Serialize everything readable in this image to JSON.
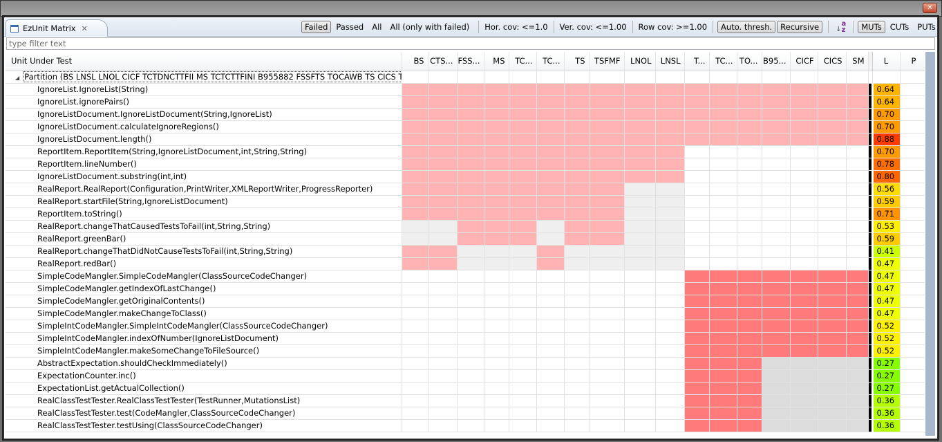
{
  "view": {
    "tab_label": "EzUnit Matrix",
    "filter_placeholder": "type filter text"
  },
  "toolbar": {
    "filters": [
      {
        "label": "Failed",
        "pressed": true
      },
      {
        "label": "Passed",
        "pressed": false
      },
      {
        "label": "All",
        "pressed": false
      },
      {
        "label": "All (only with failed)",
        "pressed": false
      }
    ],
    "hor_cov": "Hor. cov: <=1.0",
    "ver_cov": "Ver. cov: <=1.00",
    "row_cov": "Row cov: >=1.00",
    "auto_thresh": "Auto. thresh.",
    "recursive": "Recursive",
    "sort_icon": "sort-az-icon",
    "units": [
      {
        "label": "MUTs",
        "pressed": true
      },
      {
        "label": "CUTs",
        "pressed": false
      },
      {
        "label": "PUTs",
        "pressed": false
      }
    ],
    "sync_icon": "sync-icon",
    "menu_icon": "view-menu-icon"
  },
  "table": {
    "name_header": "Unit Under Test",
    "columns": [
      "BS",
      "CTS...",
      "FSS...",
      "MS",
      "TC...",
      "TC...",
      "TS",
      "TSFMF",
      "LNOL",
      "LNSL",
      "T...",
      "TC...",
      "TO...",
      "B95...",
      "CICF",
      "CICS",
      "SM"
    ],
    "l_header": "L",
    "p_header": "P",
    "partition_label": "Partition (BS LNSL LNOL CICF TCTDNCTTFII MS TCTCTTFINI B955882 FSSFTS TOCAWB TS CICS TSFMF",
    "cell_legend": {
      "p": "failed (light)",
      "r": "failed (strong)",
      "g": "not covered",
      "d": "not covered (dark)",
      "w": "empty"
    },
    "colors": {
      "p": "#ffb3b3",
      "r": "#ff7a7a",
      "g": "#efefef",
      "d": "#dcdcdc"
    },
    "rows": [
      {
        "name": "IgnoreList.IgnoreList(String)",
        "cells": "ppppppppppppppppp",
        "l": "0.64",
        "l_color": "#ffb400"
      },
      {
        "name": "IgnoreList.ignorePairs()",
        "cells": "ppppppppppppppppp",
        "l": "0.64",
        "l_color": "#ffb400"
      },
      {
        "name": "IgnoreListDocument.IgnoreListDocument(String,IgnoreList)",
        "cells": "ppppppppppppppppp",
        "l": "0.70",
        "l_color": "#ff9a00"
      },
      {
        "name": "IgnoreListDocument.calculateIgnoreRegions()",
        "cells": "ppppppppppppppppp",
        "l": "0.70",
        "l_color": "#ff9a00"
      },
      {
        "name": "IgnoreListDocument.length()",
        "cells": "ppppppppppppppppp",
        "l": "0.88",
        "l_color": "#ff3c00"
      },
      {
        "name": "ReportItem.ReportItem(String,IgnoreListDocument,int,String,String)",
        "cells": "ppppppppppwwwwwww",
        "l": "0.70",
        "l_color": "#ff9a00"
      },
      {
        "name": "ReportItem.lineNumber()",
        "cells": "ppppppppppwwwwwww",
        "l": "0.78",
        "l_color": "#ff6e00"
      },
      {
        "name": "IgnoreListDocument.substring(int,int)",
        "cells": "ppppppppppwwwwwww",
        "l": "0.80",
        "l_color": "#ff6600"
      },
      {
        "name": "RealReport.RealReport(Configuration,PrintWriter,XMLReportWriter,ProgressReporter)",
        "cells": "ppppppppggwwwwwww",
        "l": "0.56",
        "l_color": "#ffdc00"
      },
      {
        "name": "RealReport.startFile(String,IgnoreListDocument)",
        "cells": "ppppppppggwwwwwww",
        "l": "0.59",
        "l_color": "#ffcc00"
      },
      {
        "name": "ReportItem.toString()",
        "cells": "ppppppppggwwwwwww",
        "l": "0.71",
        "l_color": "#ff9400"
      },
      {
        "name": "RealReport.changeThatCausedTestsToFail(int,String,String)",
        "cells": "ggpppgppggwwwwwww",
        "l": "0.53",
        "l_color": "#ffee00"
      },
      {
        "name": "RealReport.greenBar()",
        "cells": "ggpppgppggwwwwwww",
        "l": "0.59",
        "l_color": "#ffcc00"
      },
      {
        "name": "RealReport.changeThatDidNotCauseTestsToFail(int,String,String)",
        "cells": "ppgggpggggwwwwwww",
        "l": "0.41",
        "l_color": "#ccff00"
      },
      {
        "name": "RealReport.redBar()",
        "cells": "ppgggpggggwwwwwww",
        "l": "0.47",
        "l_color": "#eeff00"
      },
      {
        "name": "SimpleCodeMangler.SimpleCodeMangler(ClassSourceCodeChanger)",
        "cells": "wwwwwwwwwwrrrrrrr",
        "l": "0.47",
        "l_color": "#eeff00"
      },
      {
        "name": "SimpleCodeMangler.getIndexOfLastChange()",
        "cells": "wwwwwwwwwwrrrrrrr",
        "l": "0.47",
        "l_color": "#eeff00"
      },
      {
        "name": "SimpleCodeMangler.getOriginalContents()",
        "cells": "wwwwwwwwwwrrrrrrr",
        "l": "0.47",
        "l_color": "#eeff00"
      },
      {
        "name": "SimpleCodeMangler.makeChangeToClass()",
        "cells": "wwwwwwwwwwrrrrrrr",
        "l": "0.47",
        "l_color": "#eeff00"
      },
      {
        "name": "SimpleIntCodeMangler.SimpleIntCodeMangler(ClassSourceCodeChanger)",
        "cells": "wwwwwwwwwwrrrrrrr",
        "l": "0.52",
        "l_color": "#fff200"
      },
      {
        "name": "SimpleIntCodeMangler.indexOfNumber(IgnoreListDocument)",
        "cells": "wwwwwwwwwwrrrrrrr",
        "l": "0.52",
        "l_color": "#fff200"
      },
      {
        "name": "SimpleIntCodeMangler.makeSomeChangeToFileSource()",
        "cells": "wwwwwwwwwwrrrrrrr",
        "l": "0.52",
        "l_color": "#fff200"
      },
      {
        "name": "AbstractExpectation.shouldCheckImmediately()",
        "cells": "wwwwwwwwwwrrrdddd",
        "l": "0.27",
        "l_color": "#88ff00"
      },
      {
        "name": "ExpectationCounter.inc()",
        "cells": "wwwwwwwwwwrrrdddd",
        "l": "0.27",
        "l_color": "#88ff00"
      },
      {
        "name": "ExpectationList.getActualCollection()",
        "cells": "wwwwwwwwwwrrrdddd",
        "l": "0.27",
        "l_color": "#88ff00"
      },
      {
        "name": "RealClassTestTester.RealClassTestTester(TestRunner,MutationsList)",
        "cells": "wwwwwwwwwwrrrdddd",
        "l": "0.36",
        "l_color": "#b4ff00"
      },
      {
        "name": "RealClassTestTester.test(CodeMangler,ClassSourceCodeChanger)",
        "cells": "wwwwwwwwwwrrrdddd",
        "l": "0.36",
        "l_color": "#b4ff00"
      },
      {
        "name": "RealClassTestTester.testUsing(ClassSourceCodeChanger)",
        "cells": "wwwwwwwwwwrrrdddd",
        "l": "0.36",
        "l_color": "#b4ff00"
      }
    ]
  }
}
